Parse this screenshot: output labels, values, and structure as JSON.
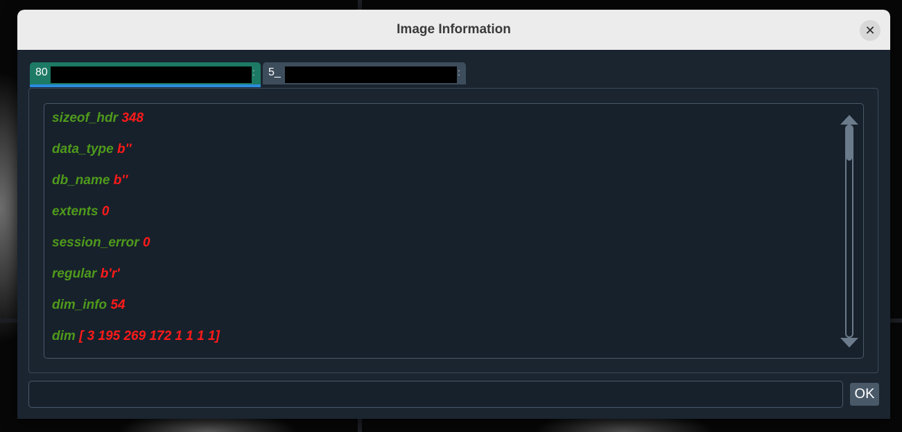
{
  "window": {
    "title": "Image Information",
    "close_glyph": "✕"
  },
  "tabs": [
    {
      "label": "80",
      "suffix": ":",
      "active": true
    },
    {
      "label": "5_",
      "suffix": ":",
      "active": false
    }
  ],
  "fields": [
    {
      "key": "sizeof_hdr",
      "value": "348"
    },
    {
      "key": "data_type",
      "value": "b''"
    },
    {
      "key": "db_name",
      "value": "b''"
    },
    {
      "key": "extents",
      "value": "0"
    },
    {
      "key": "session_error",
      "value": "0"
    },
    {
      "key": "regular",
      "value": "b'r'"
    },
    {
      "key": "dim_info",
      "value": "54"
    },
    {
      "key": "dim",
      "value": "[ 3 195 269 172 1 1 1 1]"
    }
  ],
  "input": {
    "value": "",
    "placeholder": ""
  },
  "ok_button": {
    "label": "OK"
  },
  "colors": {
    "key": "#4f9a1c",
    "value": "#ff1a1a",
    "active_tab": "#1d7a64",
    "tab_underline": "#2a8be0"
  },
  "icons": {
    "close": "close-icon",
    "scroll_up": "arrow-up-icon",
    "scroll_down": "arrow-down-icon"
  }
}
